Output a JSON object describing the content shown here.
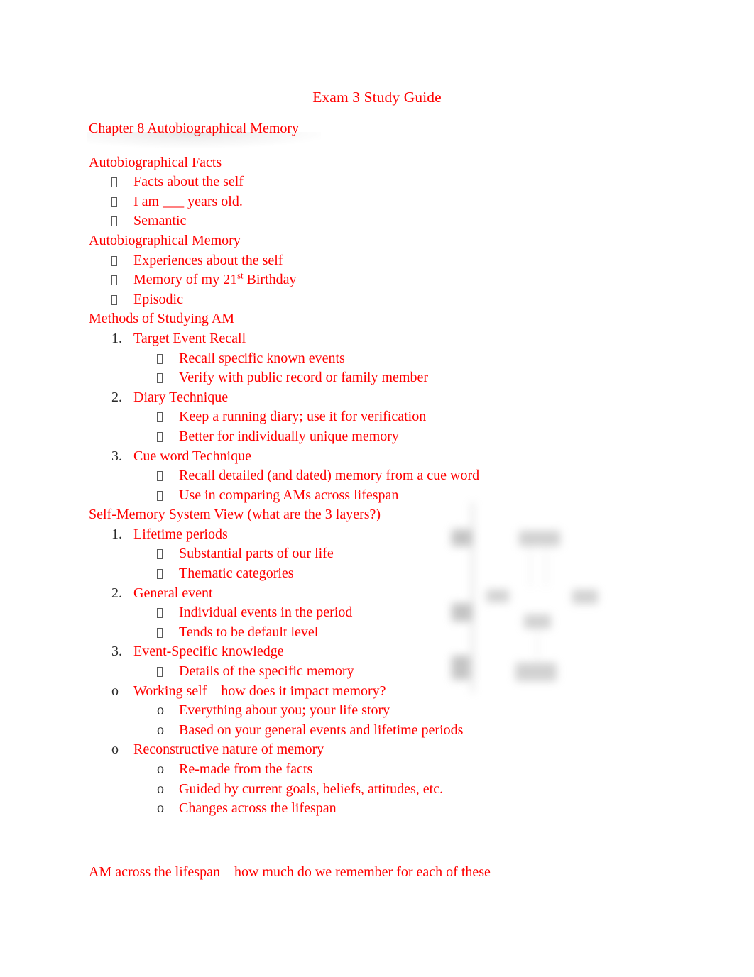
{
  "document": {
    "title": "Exam 3 Study Guide",
    "text_color": "#ff0000",
    "marker_color": "#2b2b2b",
    "page_background": "#ffffff"
  },
  "content": {
    "chapter_heading": "Chapter 8 Autobiographical Memory",
    "sections": [
      {
        "heading": "Autobiographical Facts",
        "items": [
          {
            "marker": "tofu",
            "level": 1,
            "text": "Facts about the self"
          },
          {
            "marker": "tofu",
            "level": 1,
            "text": "I am ___ years old."
          },
          {
            "marker": "tofu",
            "level": 1,
            "text": "Semantic"
          }
        ]
      },
      {
        "heading": "Autobiographical Memory",
        "items": [
          {
            "marker": "tofu",
            "level": 1,
            "text": "Experiences about the self"
          },
          {
            "marker": "tofu",
            "level": 1,
            "text_pre": "Memory of my 21",
            "superscript": "st",
            "text_post": " Birthday"
          },
          {
            "marker": "tofu",
            "level": 1,
            "text": "Episodic"
          }
        ]
      },
      {
        "heading": "Methods of Studying AM",
        "items": [
          {
            "marker": "1.",
            "level": 1,
            "text": "Target Event Recall"
          },
          {
            "marker": "tofu",
            "level": 2,
            "text": "Recall specific known events"
          },
          {
            "marker": "tofu",
            "level": 2,
            "text": "Verify with public record or family member"
          },
          {
            "marker": "2.",
            "level": 1,
            "text": "Diary Technique"
          },
          {
            "marker": "tofu",
            "level": 2,
            "text": "Keep a running diary; use it for verification"
          },
          {
            "marker": "tofu",
            "level": 2,
            "text": "Better for individually unique memory"
          },
          {
            "marker": "3.",
            "level": 1,
            "text": "Cue word Technique"
          },
          {
            "marker": "tofu",
            "level": 2,
            "text": "Recall detailed (and dated) memory from a cue word"
          },
          {
            "marker": "tofu",
            "level": 2,
            "text": "Use in comparing AMs across lifespan"
          }
        ]
      },
      {
        "heading": "Self-Memory System View (what are the 3 layers?)",
        "items": [
          {
            "marker": "1.",
            "level": 1,
            "text": "Lifetime periods"
          },
          {
            "marker": "tofu",
            "level": 2,
            "text": "Substantial parts of our life"
          },
          {
            "marker": "tofu",
            "level": 2,
            "text": "Thematic categories"
          },
          {
            "marker": "2.",
            "level": 1,
            "text": "General event"
          },
          {
            "marker": "tofu",
            "level": 2,
            "text": "Individual events in the period"
          },
          {
            "marker": "tofu",
            "level": 2,
            "text": "Tends to be default level"
          },
          {
            "marker": "3.",
            "level": 1,
            "text": "Event-Specific knowledge"
          },
          {
            "marker": "tofu",
            "level": 2,
            "text": "Details of the specific memory"
          },
          {
            "marker": "o",
            "level": 1,
            "text": "Working self – how does it impact memory?"
          },
          {
            "marker": "o",
            "level": 2,
            "text": "Everything about you; your life story"
          },
          {
            "marker": "o",
            "level": 2,
            "text": "Based on your general events and lifetime periods"
          },
          {
            "marker": "o",
            "level": 1,
            "text": "Reconstructive nature of memory"
          },
          {
            "marker": "o",
            "level": 2,
            "text": "Re-made from the facts"
          },
          {
            "marker": "o",
            "level": 2,
            "text": "Guided by current goals, beliefs, attitudes, etc."
          },
          {
            "marker": "o",
            "level": 2,
            "text": "Changes across the lifespan"
          }
        ]
      }
    ],
    "closing_line": "AM across the lifespan – how much do we remember for each of these"
  },
  "diagram": {
    "description": "faded blurred self-memory-system hierarchy figure",
    "visible_text": ""
  }
}
